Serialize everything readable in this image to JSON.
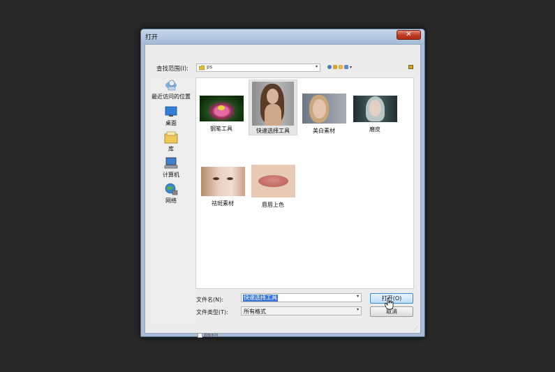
{
  "window": {
    "title": "打开",
    "close_glyph": "✕"
  },
  "toolbar": {
    "look_in_label": "查找范围(I):",
    "look_in_value": "ps",
    "view_arrow": "▾"
  },
  "places": [
    {
      "label": "最近访问的位置",
      "icon": "recent-places-icon"
    },
    {
      "label": "桌面",
      "icon": "desktop-icon"
    },
    {
      "label": "库",
      "icon": "library-icon"
    },
    {
      "label": "计算机",
      "icon": "computer-icon"
    },
    {
      "label": "网络",
      "icon": "network-icon"
    }
  ],
  "files": [
    {
      "name": "钢笔工具",
      "selected": false
    },
    {
      "name": "快速选择工具",
      "selected": true
    },
    {
      "name": "美白素材",
      "selected": false
    },
    {
      "name": "磨皮",
      "selected": false
    },
    {
      "name": "祛斑素材",
      "selected": false
    },
    {
      "name": "唇唇上色",
      "selected": false
    }
  ],
  "form": {
    "file_name_label": "文件名(N):",
    "file_name_value": "快速选择工具",
    "file_type_label": "文件类型(T):",
    "file_type_value": "所有格式",
    "dropdown_arrow": "▾",
    "open_label": "打开(O)",
    "cancel_label": "取消",
    "thumbnail_option": "图像序列"
  },
  "colors": {
    "selection": "#3874d8",
    "open_button_border": "#3a8bd6",
    "close_button": "#c03a22"
  }
}
